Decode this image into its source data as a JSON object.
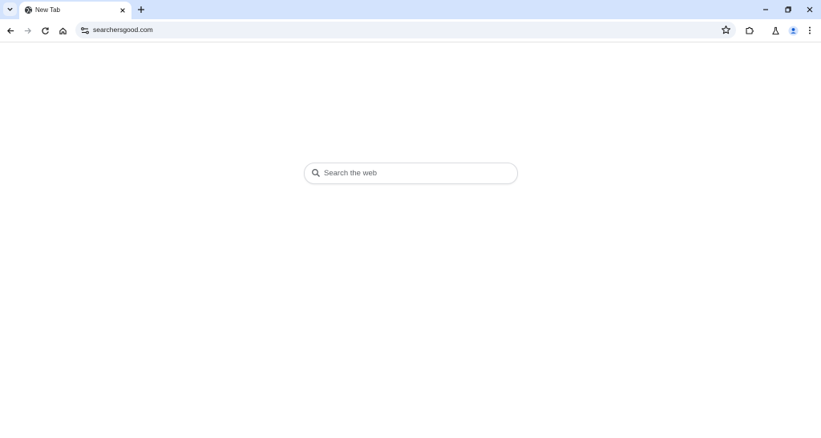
{
  "tab": {
    "title": "New Tab"
  },
  "address_bar": {
    "url": "searchersgood.com"
  },
  "search": {
    "placeholder": "Search the web"
  },
  "icons": {
    "tab_search": "chevron-down-icon",
    "favicon": "globe-icon",
    "tab_close": "close-icon",
    "new_tab": "plus-icon",
    "back": "arrow-left-icon",
    "forward": "arrow-right-icon",
    "reload": "reload-icon",
    "home": "home-icon",
    "site_info": "tune-icon",
    "bookmark": "star-icon",
    "extensions": "puzzle-icon",
    "labs": "flask-icon",
    "profile": "avatar-icon",
    "menu": "kebab-menu-icon",
    "search": "search-icon"
  },
  "colors": {
    "tabstrip": "#d3e3fd",
    "omnibox": "#eef2f8",
    "accent": "#0b57d0"
  }
}
